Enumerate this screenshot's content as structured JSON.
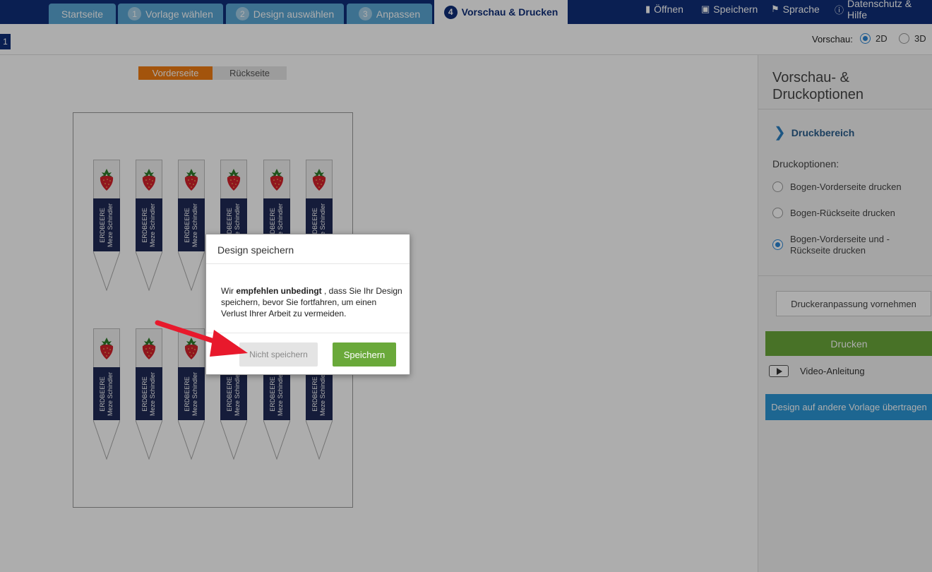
{
  "nav": {
    "tabs": [
      {
        "label": "Startseite",
        "num": ""
      },
      {
        "label": "Vorlage wählen",
        "num": "1"
      },
      {
        "label": "Design auswählen",
        "num": "2"
      },
      {
        "label": "Anpassen",
        "num": "3"
      },
      {
        "label": "Vorschau & Drucken",
        "num": "4"
      }
    ],
    "menu": {
      "open": "Öffnen",
      "save": "Speichern",
      "language": "Sprache",
      "help": "Datenschutz & Hilfe"
    }
  },
  "subbar": {
    "page_number": "1",
    "preview_label": "Vorschau:",
    "option_2d": "2D",
    "option_3d": "3D"
  },
  "canvas": {
    "front_label": "Vorderseite",
    "back_label": "Rückseite",
    "label_line1": "ERDBEERE",
    "label_line2": "Meze Schindler"
  },
  "panel": {
    "title": "Vorschau- & Druckoptionen",
    "druckbereich": "Druckbereich",
    "druckoptionen_label": "Druckoptionen:",
    "options": [
      "Bogen-Vorderseite drucken",
      "Bogen-Rückseite drucken",
      "Bogen-Vorderseite und -Rückseite drucken"
    ],
    "selected_option_index": 2,
    "printer_adjust": "Druckeranpassung vornehmen",
    "print": "Drucken",
    "video": "Video-Anleitung",
    "transfer": "Design auf andere Vorlage übertragen"
  },
  "modal": {
    "title": "Design speichern",
    "text_before": "Wir ",
    "text_bold": "empfehlen unbedingt",
    "text_after": " , dass Sie Ihr Design speichern, bevor Sie fortfahren, um einen Verlust Ihrer Arbeit zu vermeiden.",
    "dont_save": "Nicht speichern",
    "save": "Speichern"
  },
  "colors": {
    "nav_bg": "#0f2f7a",
    "tab_bg": "#5aa7d4",
    "accent_orange": "#f07c12",
    "green": "#6aa93a",
    "blue": "#2b97d6",
    "label_navy": "#1f2a56",
    "arrow_red": "#e8192c"
  }
}
